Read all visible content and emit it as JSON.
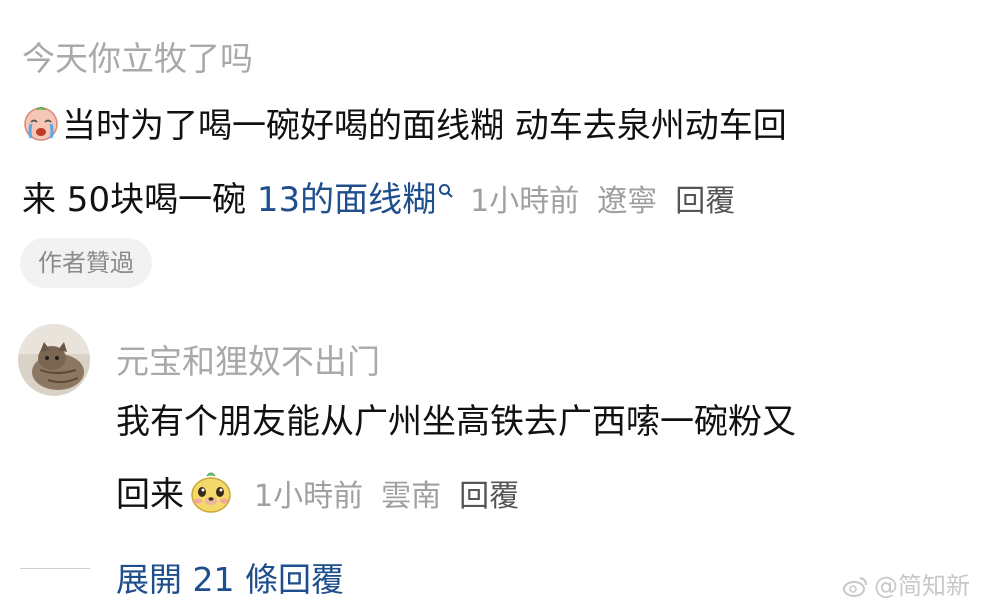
{
  "comment1": {
    "username": "今天你立牧了吗",
    "emoji": "crying-face-icon",
    "line1": "当时为了喝一碗好喝的面线糊 动车去泉州动车回",
    "line2_prefix": "来 50块喝一碗 ",
    "line2_link": "13的面线糊",
    "time": "1小時前",
    "location": "遼寧",
    "reply": "回覆",
    "author_badge": "作者贊過"
  },
  "comment2": {
    "username": "元宝和狸奴不出门",
    "avatar": "cat-avatar",
    "line1": "我有个朋友能从广州坐高铁去广西嗦一碗粉又",
    "line2": "回来",
    "emoji": "dog-face-icon",
    "time": "1小時前",
    "location": "雲南",
    "reply": "回覆"
  },
  "expand_replies": "展開 21 條回覆",
  "watermark": "@简知新",
  "colors": {
    "text": "#111111",
    "muted": "#a0a0a0",
    "link": "#1f4e8c",
    "badge_bg": "#f2f2f2"
  }
}
